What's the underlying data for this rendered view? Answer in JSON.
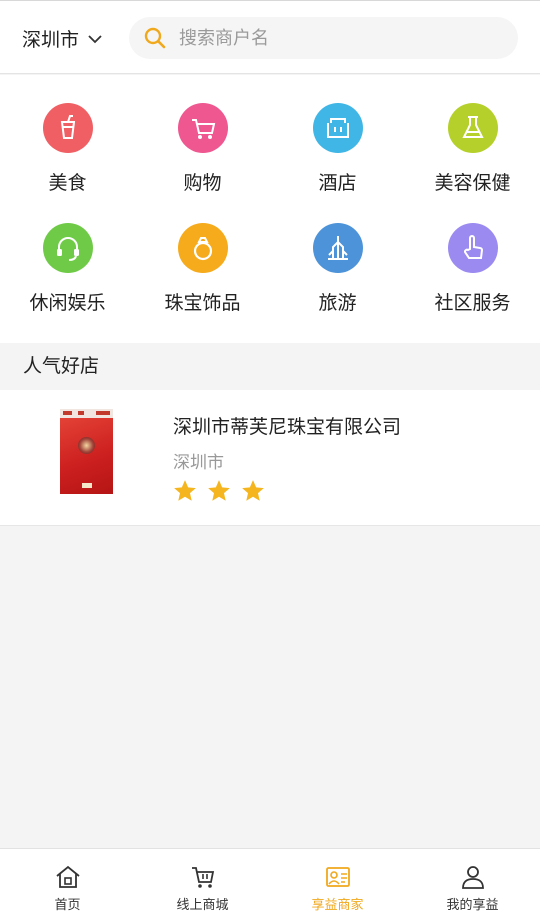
{
  "header": {
    "city": "深圳市",
    "search_placeholder": "搜索商户名",
    "icons": {
      "city_dropdown": "chevron-down-icon",
      "search": "search-icon"
    }
  },
  "categories": [
    {
      "label": "美食",
      "icon": "drink-cup-icon",
      "color": "#ef5f63"
    },
    {
      "label": "购物",
      "icon": "shopping-cart-icon",
      "color": "#ee5790"
    },
    {
      "label": "酒店",
      "icon": "hotel-building-icon",
      "color": "#3fb6e5"
    },
    {
      "label": "美容保健",
      "icon": "flask-icon",
      "color": "#b6d02b"
    },
    {
      "label": "休闲娱乐",
      "icon": "headset-icon",
      "color": "#6fcb47"
    },
    {
      "label": "珠宝饰品",
      "icon": "ring-icon",
      "color": "#f5ab1b"
    },
    {
      "label": "旅游",
      "icon": "travel-tower-icon",
      "color": "#4d93d9"
    },
    {
      "label": "社区服务",
      "icon": "hand-pointer-icon",
      "color": "#9b8af0"
    }
  ],
  "section": {
    "title": "人气好店"
  },
  "stores": [
    {
      "name": "深圳市蒂芙尼珠宝有限公司",
      "city": "深圳市",
      "rating": 3
    }
  ],
  "accent_color": "#f0a81d",
  "tabbar": {
    "items": [
      {
        "label": "首页",
        "icon": "home-icon"
      },
      {
        "label": "线上商城",
        "icon": "cart-icon"
      },
      {
        "label": "享益商家",
        "icon": "merchant-card-icon",
        "active": true
      },
      {
        "label": "我的享益",
        "icon": "user-icon"
      }
    ]
  }
}
